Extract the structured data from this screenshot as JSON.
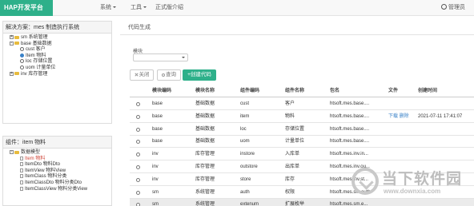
{
  "navbar": {
    "brand": "HAP开发平台",
    "menus": [
      {
        "label": "系统"
      },
      {
        "label": "工具"
      },
      {
        "label": "正式版介绍"
      }
    ],
    "user": "管理员"
  },
  "solution_panel": {
    "title": "解决方案：mes 制造执行系统",
    "tree": [
      {
        "expander": "+",
        "label": "sm 系统管理",
        "level": 0
      },
      {
        "expander": "-",
        "label": "base 基础数据",
        "level": 0
      },
      {
        "label": "cust 客户",
        "level": 1
      },
      {
        "label": "Item 物料",
        "level": 1,
        "selected": true
      },
      {
        "label": "loc 存储位置",
        "level": 1
      },
      {
        "label": "uom 计量单位",
        "level": 1
      },
      {
        "expander": "+",
        "label": "inv 库存管理",
        "level": 0
      }
    ]
  },
  "component_panel": {
    "title": "组件：item 物料",
    "tree": [
      {
        "expander": "-",
        "label": "数据模型",
        "level": 0
      },
      {
        "label": "Item 物料",
        "level": 1,
        "highlight": true
      },
      {
        "label": "ItemDto 物料Dto",
        "level": 1
      },
      {
        "label": "ItemView 物料View",
        "level": 1
      },
      {
        "label": "ItemClass 物料分类",
        "level": 1
      },
      {
        "label": "ItemClassDto 物料分类Dto",
        "level": 1
      },
      {
        "label": "ItemClassView 物料分类View",
        "level": 1
      }
    ]
  },
  "main": {
    "title": "代码生成",
    "module_label": "模块",
    "module_select_value": "",
    "buttons": {
      "close": "关闭",
      "query": "查询",
      "create": "+创建代码"
    },
    "table": {
      "headers": [
        "模块编码",
        "模块名称",
        "组件编码",
        "组件名称",
        "包名",
        "文件",
        "创建时间"
      ],
      "rows": [
        [
          "base",
          "基础数据",
          "cust",
          "客户",
          "htsoft.mes.base....",
          "",
          ""
        ],
        [
          "base",
          "基础数据",
          "item",
          "物料",
          "htsoft.mes.base....",
          "下载 删除",
          "2021-07-11 17:41:07"
        ],
        [
          "base",
          "基础数据",
          "loc",
          "存储位置",
          "htsoft.mes.base....",
          "",
          ""
        ],
        [
          "base",
          "基础数据",
          "uom",
          "计量单位",
          "htsoft.mes.base....",
          "",
          ""
        ],
        [
          "inv",
          "库存管理",
          "instore",
          "入库单",
          "htsoft.mes.inv.in...",
          "",
          ""
        ],
        [
          "inv",
          "库存管理",
          "outstore",
          "出库单",
          "htsoft.mes.inv.ou...",
          "",
          ""
        ],
        [
          "inv",
          "库存管理",
          "store",
          "库存",
          "htsoft.mes.inv.st...",
          "",
          ""
        ],
        [
          "sm",
          "系统管理",
          "auth",
          "权限",
          "htsoft.mes.sm.auth",
          "",
          ""
        ],
        [
          "sm",
          "系统管理",
          "extenum",
          "扩展枚举",
          "htsoft.mes.sm.e...",
          "",
          ""
        ]
      ]
    }
  },
  "watermark": {
    "text": "当下软件园",
    "url": "www.downxia.com"
  },
  "colors": {
    "brand": "#2eb08a",
    "link": "#3a82c8"
  }
}
